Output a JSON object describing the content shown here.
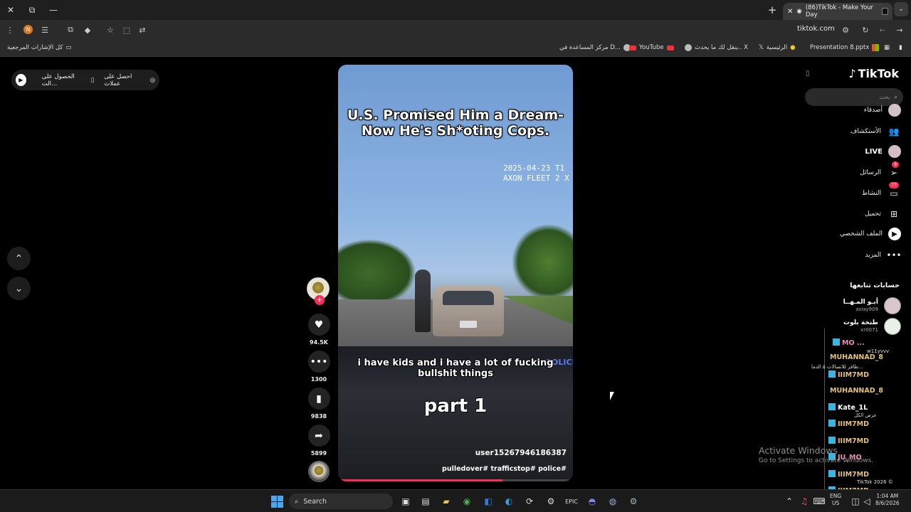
{
  "browser": {
    "tab_title": "(86)TikTok - Make Your Day",
    "url": "tiktok.com",
    "profile_initial": "N",
    "bookmarks": [
      {
        "label": "كل الإشارات المرجعية"
      },
      {
        "label": "مركز المساعدة في D..."
      },
      {
        "label": "YouTube"
      },
      {
        "label": "ينقل لك ما يحدث.. X"
      },
      {
        "label": "الرئيسية"
      },
      {
        "label": "Presentation 8.pptx"
      }
    ]
  },
  "left": {
    "get_app_1": "احصل على عملات",
    "get_app_2": "الحصول على الت..."
  },
  "video": {
    "title_line1": "U.S. Promised Him a Dream-",
    "title_line2": "Now He's Sh*oting Cops.",
    "timestamp_line1": "2025-04-23 T1",
    "timestamp_line2": "AXON FLEET 2 X",
    "police_text": "POLICE",
    "subtitle_line1": "i have kids and i have a lot of fucking",
    "subtitle_line2": "bullshit things",
    "part_text": "part 1",
    "username": "user15267946186387",
    "hashtags": "pulledover# trafficstop# police#",
    "progress": 0.7
  },
  "actions": {
    "likes": "94.5K",
    "comments": "1300",
    "saves": "9838",
    "shares": "5899"
  },
  "sidebar": {
    "logo": "TikTok",
    "search_placeholder": "بحث",
    "nav": {
      "friends_partial": "أصدقاء",
      "explore": "الأستكشاف",
      "live": "LIVE",
      "messages": "الرسائل",
      "messages_badge": "9",
      "activity": "النشاط",
      "activity_badge": "77",
      "upload": "تحميل",
      "profile": "الملف الشخصي",
      "more": "المزيد"
    },
    "following_title": "حسابات تتابعها",
    "following": [
      {
        "name": "أبـو المـهــا",
        "handle": "aslay909"
      },
      {
        "name": "طنخة بلوت",
        "handle": "xr0071"
      }
    ]
  },
  "overlay": {
    "c1": "MO ...",
    "c1b": "w11yvvv",
    "c2": "MUHANNAD_8",
    "c2b": "ظافر للاتصالات ۵ الدما...",
    "c3": "IIIM7MD",
    "c4": "MUHANNAD_8",
    "c5": "Kate_1L",
    "c5b": "عرض الكل",
    "c6": "IIIM7MD",
    "c7": "IIIM7MD",
    "c8": "JU_MO",
    "c9": "IIIM7MD",
    "c9b": "TikTok 2026 ©",
    "c10": "IIIM7MD"
  },
  "activate": {
    "line1": "Activate Windows",
    "line2": "Go to Settings to activate Windows."
  },
  "taskbar": {
    "search": "Search",
    "lang_1": "ENG",
    "lang_2": "US",
    "time": "1:04 AM",
    "date": "8/6/2026"
  },
  "colors": {
    "accent": "#fe2c55",
    "background": "#000000"
  }
}
